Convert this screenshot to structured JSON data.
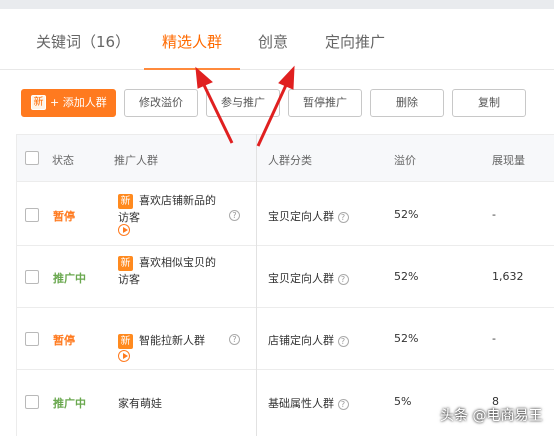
{
  "tabs": [
    {
      "label": "关键词（16）"
    },
    {
      "label": "精选人群"
    },
    {
      "label": "创意"
    },
    {
      "label": "定向推广"
    }
  ],
  "toolbar": {
    "add_tag": "新",
    "add_label": "+ 添加人群",
    "modify_premium": "修改溢价",
    "join_promo": "参与推广",
    "pause_promo": "暂停推广",
    "delete": "删除",
    "copy": "复制"
  },
  "table": {
    "headers": {
      "status": "状态",
      "crowd": "推广人群",
      "category": "人群分类",
      "premium": "溢价",
      "impressions": "展现量"
    },
    "rows": [
      {
        "status": "暂停",
        "status_type": "paused",
        "is_new": true,
        "new_tag": "新",
        "name_line1": "喜欢店铺新品的",
        "name_line2": "访客",
        "has_play": true,
        "category": "宝贝定向人群",
        "premium": "52%",
        "impressions": "-"
      },
      {
        "status": "推广中",
        "status_type": "active",
        "is_new": true,
        "new_tag": "新",
        "name_line1": "喜欢相似宝贝的",
        "name_line2": "访客",
        "has_play": false,
        "category": "宝贝定向人群",
        "premium": "52%",
        "impressions": "1,632"
      },
      {
        "status": "暂停",
        "status_type": "paused",
        "is_new": true,
        "new_tag": "新",
        "name_line1": "智能拉新人群",
        "name_line2": "",
        "has_play": true,
        "category": "店铺定向人群",
        "premium": "52%",
        "impressions": "-"
      },
      {
        "status": "推广中",
        "status_type": "active",
        "is_new": false,
        "new_tag": "",
        "name_line1": "家有萌娃",
        "name_line2": "",
        "has_play": false,
        "category": "基础属性人群",
        "premium": "5%",
        "impressions": "8"
      }
    ]
  },
  "watermark": "头条 @电商易王",
  "colors": {
    "accent": "#ff7a1f",
    "active_status": "#6aa84f",
    "arrow": "#e02020"
  }
}
